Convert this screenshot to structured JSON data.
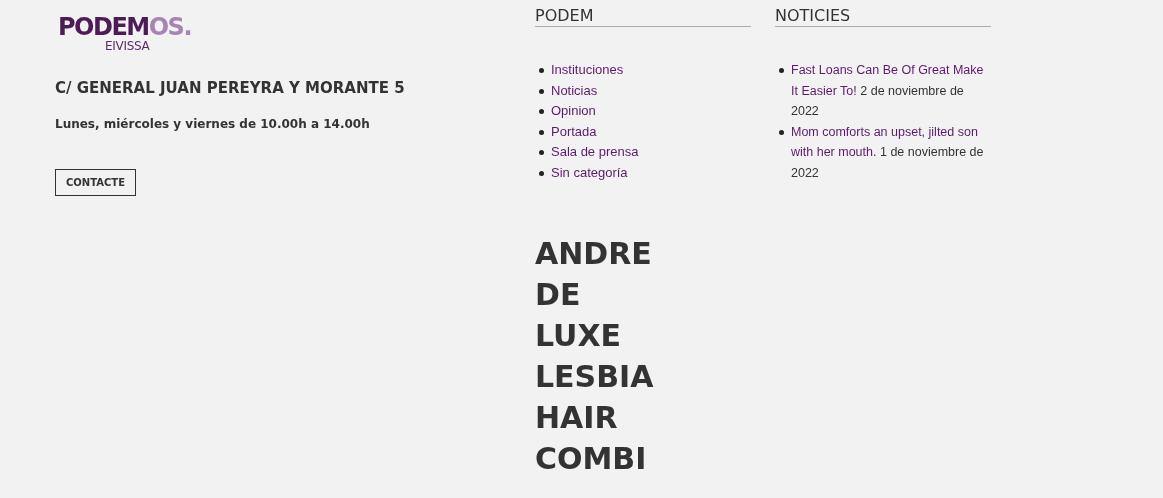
{
  "logo": {
    "main_dark": "PODEM",
    "main_light": "OS.",
    "sub": "EIVISSA"
  },
  "address": "C/ GENERAL JUAN PEREYRA Y MORANTE 5",
  "hours": "Lunes, miércoles y viernes de 10.00h a 14.00h",
  "contact_button": "CONTACTE",
  "categories": {
    "title": "PODEM",
    "items": [
      "Instituciones",
      "Noticias",
      "Opinion",
      "Portada",
      "Sala de prensa",
      "Sin categoría"
    ]
  },
  "news": {
    "title": "NOTICIES",
    "items": [
      {
        "link": "Fast Loans Can Be Of Great Make It Easier To!",
        "date": "2 de noviembre de 2022"
      },
      {
        "link": "Mom comforts an upset, jilted son with her mouth.",
        "date": "1 de noviembre de 2022"
      }
    ]
  },
  "post_title": [
    "ANDRE",
    "DE",
    "LUXE",
    "LESBIA",
    "HAIR",
    "COMBI"
  ]
}
